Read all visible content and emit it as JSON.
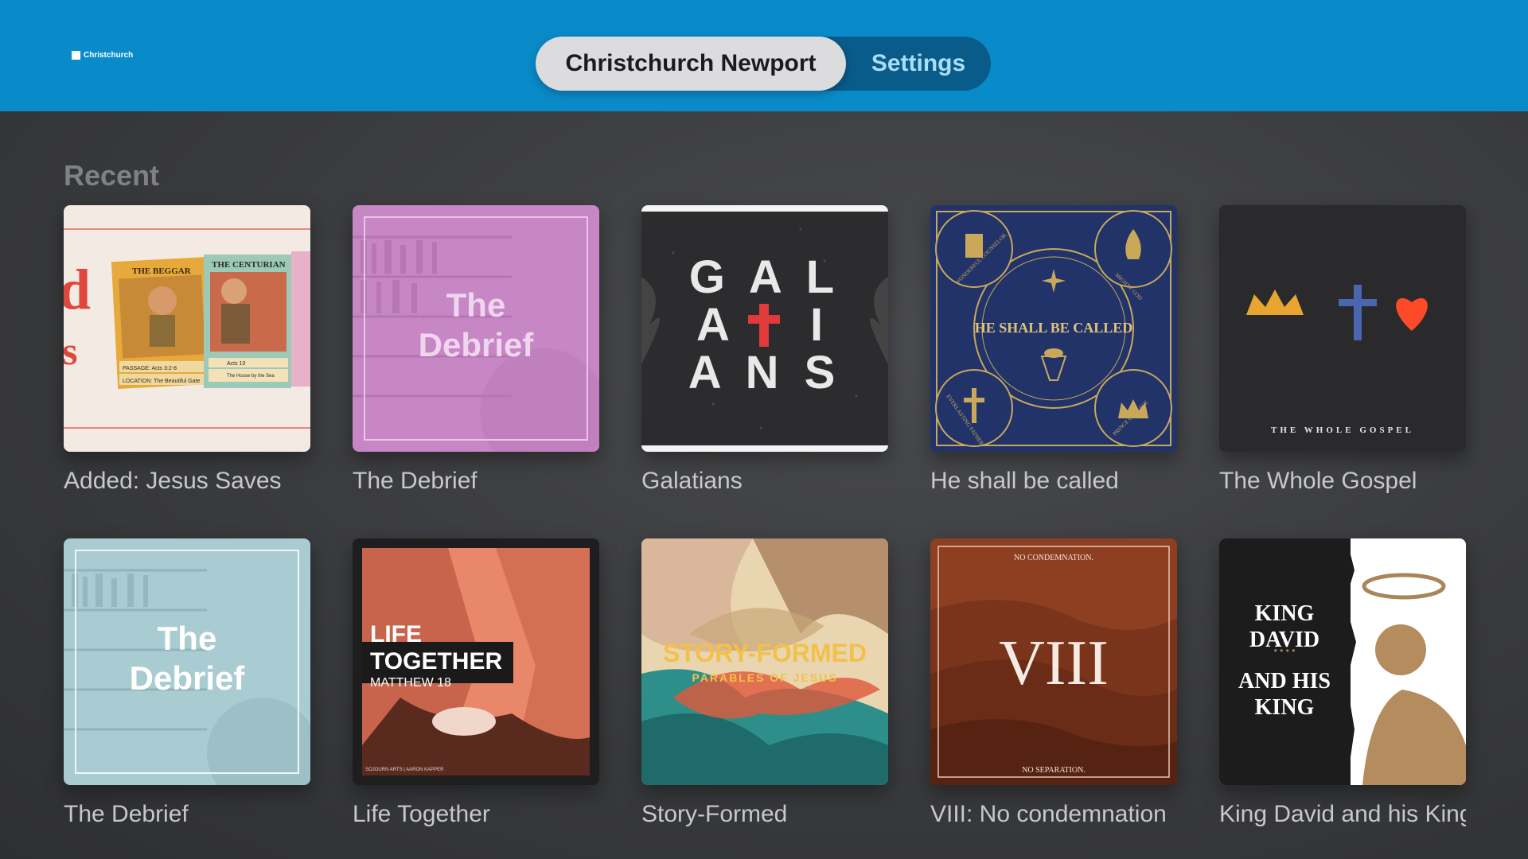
{
  "header": {
    "logo_text": "Christchurch",
    "tabs": [
      {
        "label": "Christchurch Newport",
        "selected": true
      },
      {
        "label": "Settings",
        "selected": false
      }
    ]
  },
  "recent": {
    "title": "Recent",
    "items": [
      {
        "label": "Added: Jesus Saves",
        "art": {
          "texts": [
            "THE BEGGAR",
            "THE CENTURIAN",
            "PASSAGE: Acts 3:2-8",
            "LOCATION: The Beautiful Gate",
            "Acts 10",
            "The House by the Sea",
            "d",
            "s"
          ]
        }
      },
      {
        "label": "The Debrief",
        "art": {
          "texts": [
            "The",
            "Debrief"
          ]
        }
      },
      {
        "label": "Galatians",
        "art": {
          "texts": [
            "G A L",
            "A",
            "I",
            "A N S"
          ]
        }
      },
      {
        "label": "He shall be called",
        "art": {
          "texts": [
            "HE SHALL BE CALLED",
            "WONDERFUL COUNSELOR",
            "MIGHTY GOD",
            "EVERLASTING FATHER",
            "PRINCE OF PEACE"
          ]
        }
      },
      {
        "label": "The Whole Gospel",
        "art": {
          "texts": [
            "THE   WHOLE   GOSPEL"
          ]
        }
      },
      {
        "label": "The Debrief",
        "art": {
          "texts": [
            "The",
            "Debrief"
          ]
        }
      },
      {
        "label": "Life Together",
        "art": {
          "texts": [
            "LIFE",
            "TOGETHER",
            "MATTHEW 18",
            "SOJOURN ARTS | AARON KAPPER"
          ]
        }
      },
      {
        "label": "Story-Formed",
        "art": {
          "texts": [
            "STORY-FORMED",
            "PARABLES OF JESUS"
          ]
        }
      },
      {
        "label": "VIII: No condemnation",
        "art": {
          "texts": [
            "NO CONDEMNATION.",
            "VIII",
            "NO SEPARATION."
          ]
        }
      },
      {
        "label": "King David and his King",
        "art": {
          "texts": [
            "KING",
            "DAVID",
            "AND HIS",
            "KING"
          ]
        }
      }
    ]
  }
}
